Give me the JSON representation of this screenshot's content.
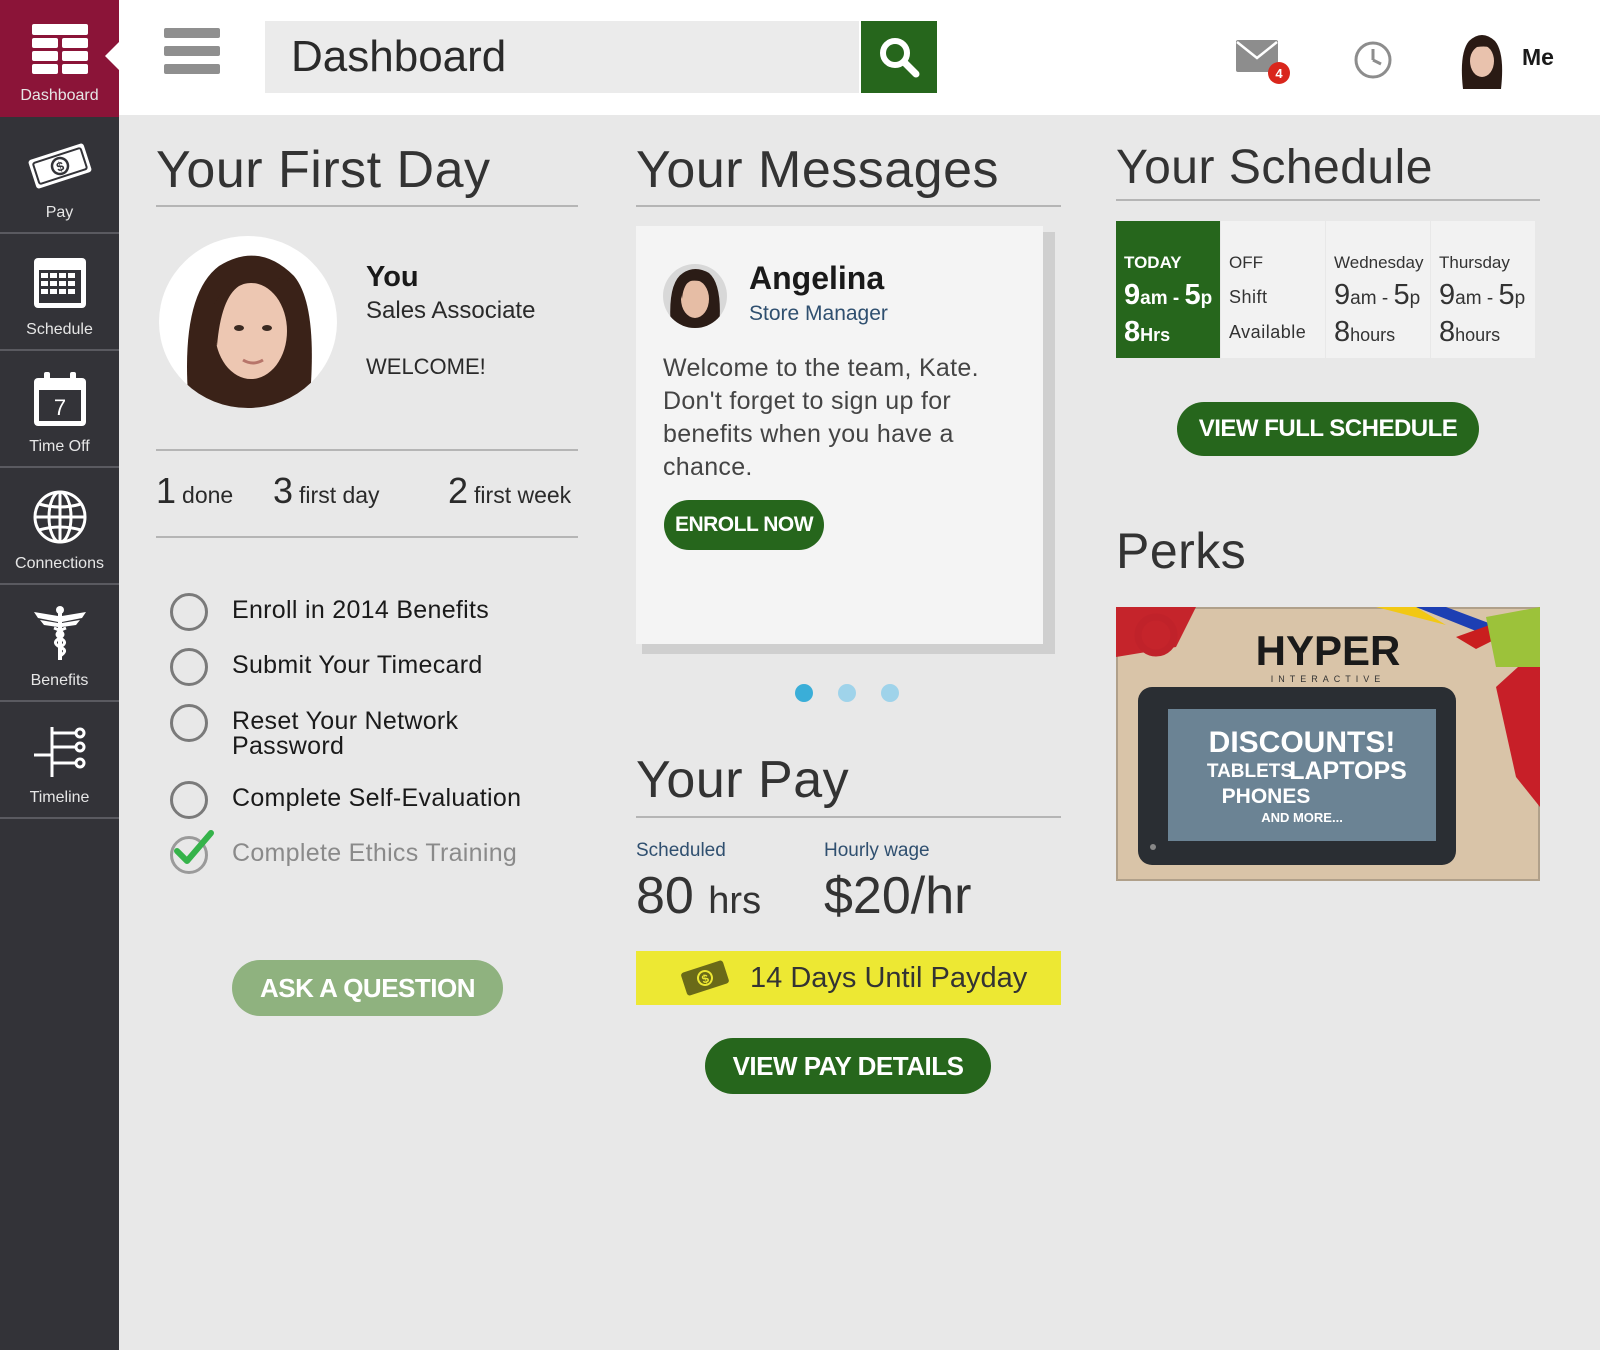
{
  "sidebar": {
    "items": [
      {
        "label": "Dashboard",
        "icon": "grid-icon"
      },
      {
        "label": "Pay",
        "icon": "money-icon"
      },
      {
        "label": "Schedule",
        "icon": "calendar-grid-icon"
      },
      {
        "label": "Time Off",
        "icon": "calendar-day-icon",
        "icon_text": "7"
      },
      {
        "label": "Connections",
        "icon": "globe-icon"
      },
      {
        "label": "Benefits",
        "icon": "caduceus-icon"
      },
      {
        "label": "Timeline",
        "icon": "timeline-icon"
      }
    ],
    "active_color": "#8b1438",
    "bg_color": "#333338"
  },
  "header": {
    "search_value": "Dashboard",
    "mail_badge": "4",
    "user_label": "Me"
  },
  "first_day": {
    "title": "Your First Day",
    "name": "You",
    "role": "Sales Associate",
    "welcome": "WELCOME!",
    "stats": [
      {
        "num": "1",
        "label": "done"
      },
      {
        "num": "3",
        "label": "first day"
      },
      {
        "num": "2",
        "label": "first week"
      }
    ],
    "tasks": [
      {
        "label": "Enroll in 2014 Benefits",
        "done": false
      },
      {
        "label": "Submit Your Timecard",
        "done": false
      },
      {
        "label": "Reset Your Network Password",
        "done": false
      },
      {
        "label": "Complete Self-Evaluation",
        "done": false
      },
      {
        "label": "Complete Ethics Training",
        "done": true
      }
    ],
    "ask_button": "ASK A QUESTION"
  },
  "messages": {
    "title": "Your Messages",
    "sender": "Angelina",
    "sender_role": "Store Manager",
    "body": "Welcome to the team, Kate. Don't forget to sign up for benefits when you have a chance.",
    "enroll_button": "ENROLL NOW"
  },
  "pay": {
    "title": "Your Pay",
    "scheduled_label": "Scheduled",
    "scheduled_value": "80",
    "scheduled_unit": "hrs",
    "wage_label": "Hourly wage",
    "wage_value": "$20/hr",
    "payday_text": "14 Days Until Payday",
    "details_button": "VIEW PAY DETAILS"
  },
  "schedule": {
    "title": "Your Schedule",
    "days": [
      {
        "name": "TODAY",
        "start": "9",
        "start_unit": "am",
        "sep": " - ",
        "end": "5",
        "end_unit": "p",
        "hours": "8",
        "hours_unit": "Hrs"
      },
      {
        "name": "OFF",
        "line1": "Shift",
        "line2": "Available"
      },
      {
        "name": "Wednesday",
        "start": "9",
        "start_unit": "am",
        "sep": " - ",
        "end": "5",
        "end_unit": "p",
        "hours": "8",
        "hours_unit": "hours"
      },
      {
        "name": "Thursday",
        "start": "9",
        "start_unit": "am",
        "sep": " - ",
        "end": "5",
        "end_unit": "p",
        "hours": "8",
        "hours_unit": "hours"
      }
    ],
    "full_button": "VIEW FULL SCHEDULE"
  },
  "perks": {
    "title": "Perks",
    "brand": "HYPER",
    "brand_sub": "INTERACTIVE",
    "headline": "DISCOUNTS!",
    "line1a": "TABLETS",
    "line1b": "LAPTOPS",
    "line2": "PHONES",
    "line3": "AND MORE..."
  },
  "colors": {
    "accent_green": "#26661c",
    "muted_green": "#8fb27f",
    "payday_yellow": "#ede833",
    "badge_red": "#d9261c",
    "dot_active": "#3aaed8",
    "dot_inactive": "#9fd3ea"
  }
}
